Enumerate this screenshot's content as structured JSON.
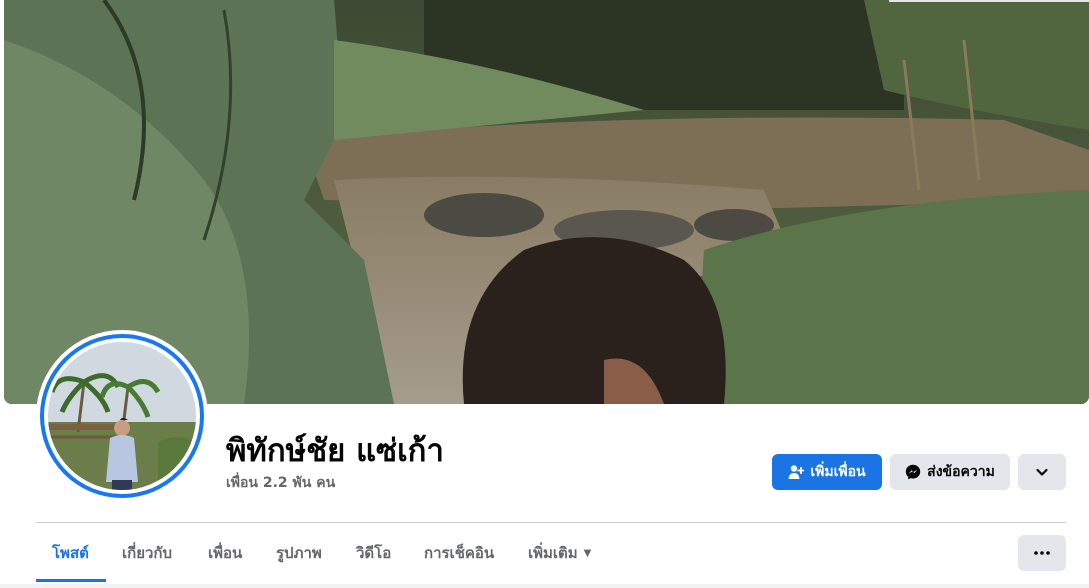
{
  "profile": {
    "name": "พิทักษ์ชัย แซ่เก้า",
    "friends": "เพื่อน 2.2 พัน คน"
  },
  "actions": {
    "add_friend": "เพิ่มเพื่อน",
    "message": "ส่งข้อความ",
    "add_friend_icon": "person-plus-icon",
    "message_icon": "messenger-icon",
    "more_icon": "chevron-down-icon"
  },
  "tabs": [
    {
      "label": "โพสต์",
      "active": true
    },
    {
      "label": "เกี่ยวกับ",
      "active": false
    },
    {
      "label": "เพื่อน",
      "active": false
    },
    {
      "label": "รูปภาพ",
      "active": false
    },
    {
      "label": "วิดีโอ",
      "active": false
    },
    {
      "label": "การเช็คอิน",
      "active": false
    },
    {
      "label": "เพิ่มเติม",
      "active": false
    }
  ],
  "tab_more_icon": "caret-down-icon",
  "overflow_icon": "ellipsis-icon",
  "colors": {
    "accent": "#1b74e4",
    "avatar_ring": "#1877f2",
    "button_gray": "#e4e6eb",
    "muted_text": "#65676b"
  }
}
